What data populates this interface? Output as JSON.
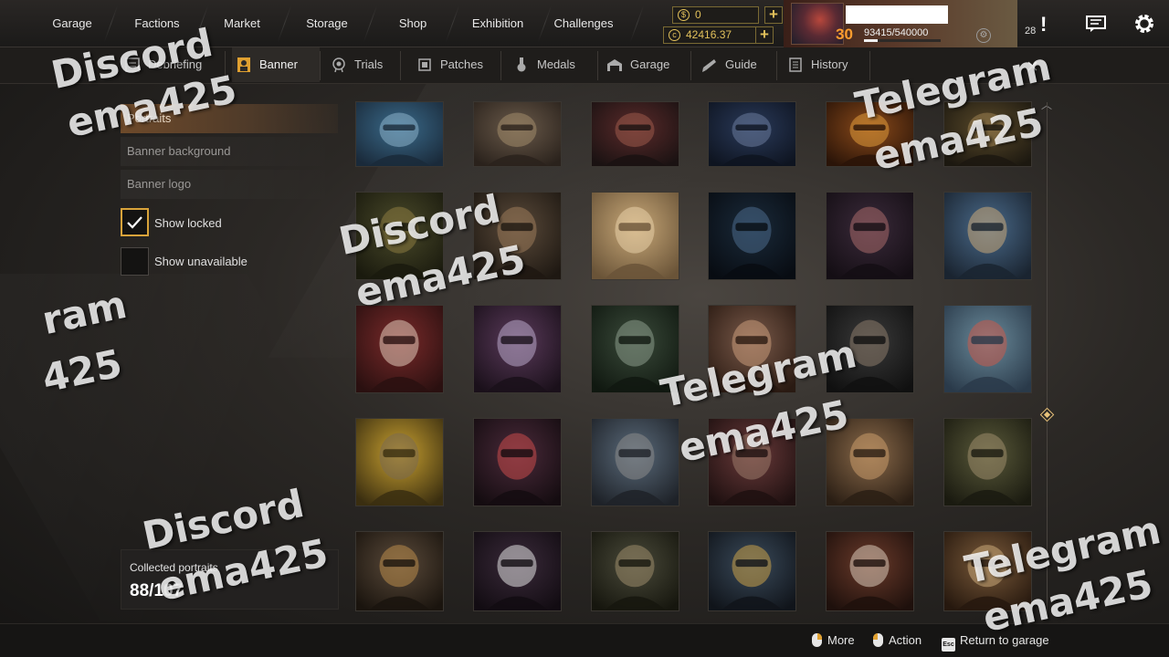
{
  "top_nav": {
    "items": [
      "Garage",
      "Factions",
      "Market",
      "Storage",
      "Shop",
      "Exhibition",
      "Challenges"
    ]
  },
  "currency": {
    "gold": "0",
    "coins": "42416.37"
  },
  "player": {
    "level": "30",
    "xp_text": "93415/540000",
    "xp_fraction": 0.173,
    "notifications": "28"
  },
  "sub_tabs": [
    "Debriefing",
    "Banner",
    "Trials",
    "Patches",
    "Medals",
    "Garage",
    "Guide",
    "History"
  ],
  "sidebar": {
    "menu": [
      "Portraits",
      "Banner background",
      "Banner logo"
    ],
    "show_locked": "Show locked",
    "show_unavailable": "Show unavailable",
    "collected_label": "Collected portraits",
    "collected_value": "88/107"
  },
  "bottom_bar": {
    "more": "More",
    "action": "Action",
    "esc": "Esc",
    "return": "Return to garage"
  },
  "watermarks": {
    "discord": "Discord",
    "telegram": "Telegram",
    "handle": "ema425",
    "gram_fragment": "ram",
    "num_fragment": "425"
  },
  "colors": {
    "accent_gold": "#d9a33a",
    "level_orange": "#ff9d2e",
    "currency_gold": "#e2c15b"
  }
}
